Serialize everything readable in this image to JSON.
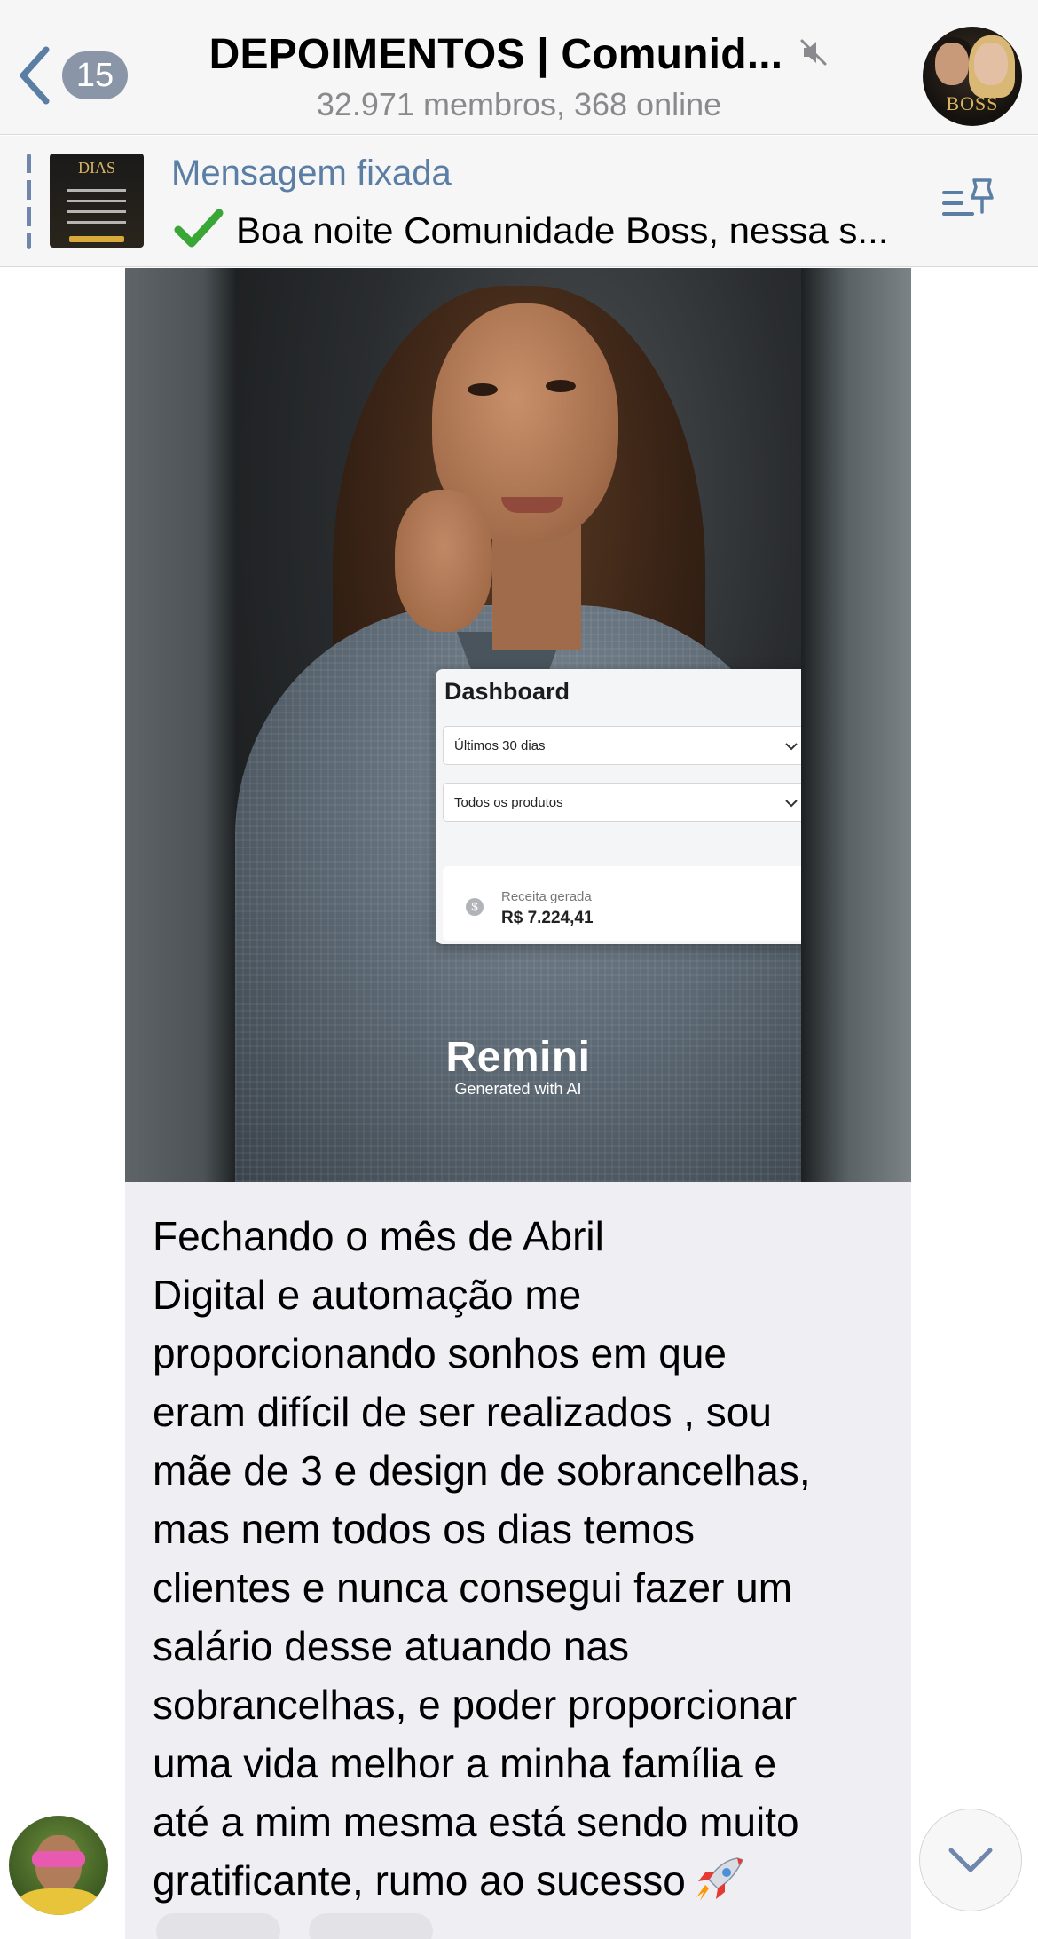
{
  "header": {
    "back_count": "15",
    "title": "DEPOIMENTOS | Comunid...",
    "subtitle": "32.971 membros, 368 online",
    "avatar_text": "BOSS",
    "back_icon": "chevron-left-icon",
    "mute_icon": "muted-icon"
  },
  "pinned": {
    "label": "Mensagem fixada",
    "text": "Boa noite Comunidade Boss, nessa s...",
    "thumb_title": "DIAS",
    "check_icon": "check-mark-icon",
    "list_icon": "pinned-list-icon"
  },
  "photo": {
    "dashboard_title": "Dashboard",
    "select_period": "Últimos 30 dias",
    "select_products": "Todos os produtos",
    "revenue_label": "Receita gerada",
    "revenue_value": "R$ 7.224,41",
    "watermark_main": "Remini",
    "watermark_sub": "Generated with AI"
  },
  "message": {
    "text": "Fechando o mês de Abril\nDigital e automação me\nproporcionando sonhos em que\neram difícil de ser realizados , sou\nmãe de 3 e design de sobrancelhas,\nmas nem todos os dias temos\nclientes e nunca consegui fazer um\nsalário desse atuando nas\nsobrancelhas, e poder proporcionar\numa vida melhor a minha família e\naté a mim mesma está sendo muito\ngratificante, rumo ao sucesso",
    "emoji": "rocket-icon"
  },
  "colors": {
    "accent": "#5b7ea5",
    "badge": "#8a96a8",
    "header_bg": "#f6f6f7",
    "bubble_bg": "#efeff3"
  }
}
